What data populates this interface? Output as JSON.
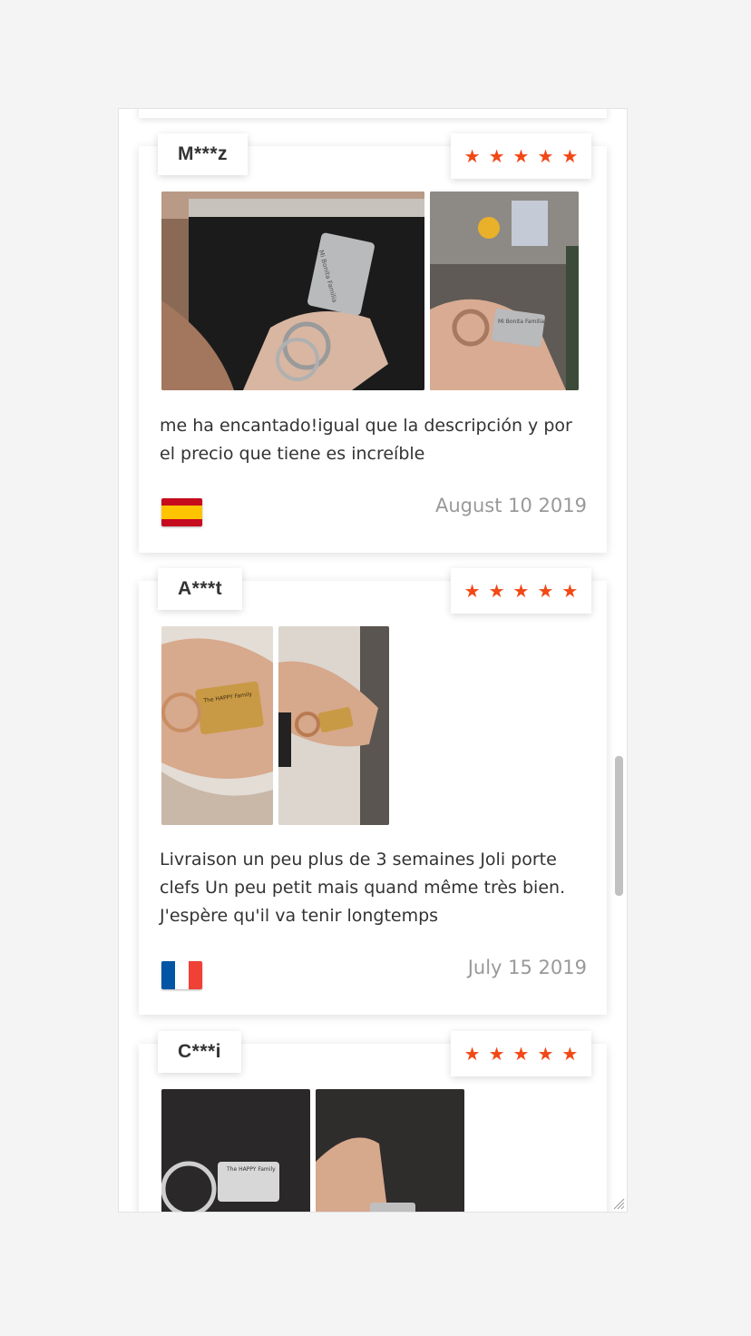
{
  "reviews": [
    {
      "name": "M***z",
      "rating": 5,
      "text": "me ha encantado!igual que la descripción y por el precio que tiene es increíble",
      "country_flag": "spain-flag",
      "date": "August 10 2019"
    },
    {
      "name": "A***t",
      "rating": 5,
      "text": "Livraison un peu plus de 3 semaines Joli porte clefs Un peu petit mais quand même très bien. J'espère qu'il va tenir longtemps",
      "country_flag": "france-flag",
      "date": "July 15 2019"
    },
    {
      "name": "C***i",
      "rating": 5
    }
  ],
  "photo_labels": {
    "happy_family": "The HAPPY Family",
    "mi_bonita": "Mi Bonita Familia"
  },
  "colors": {
    "star": "#f24816",
    "date": "#999999",
    "text": "#333333"
  }
}
